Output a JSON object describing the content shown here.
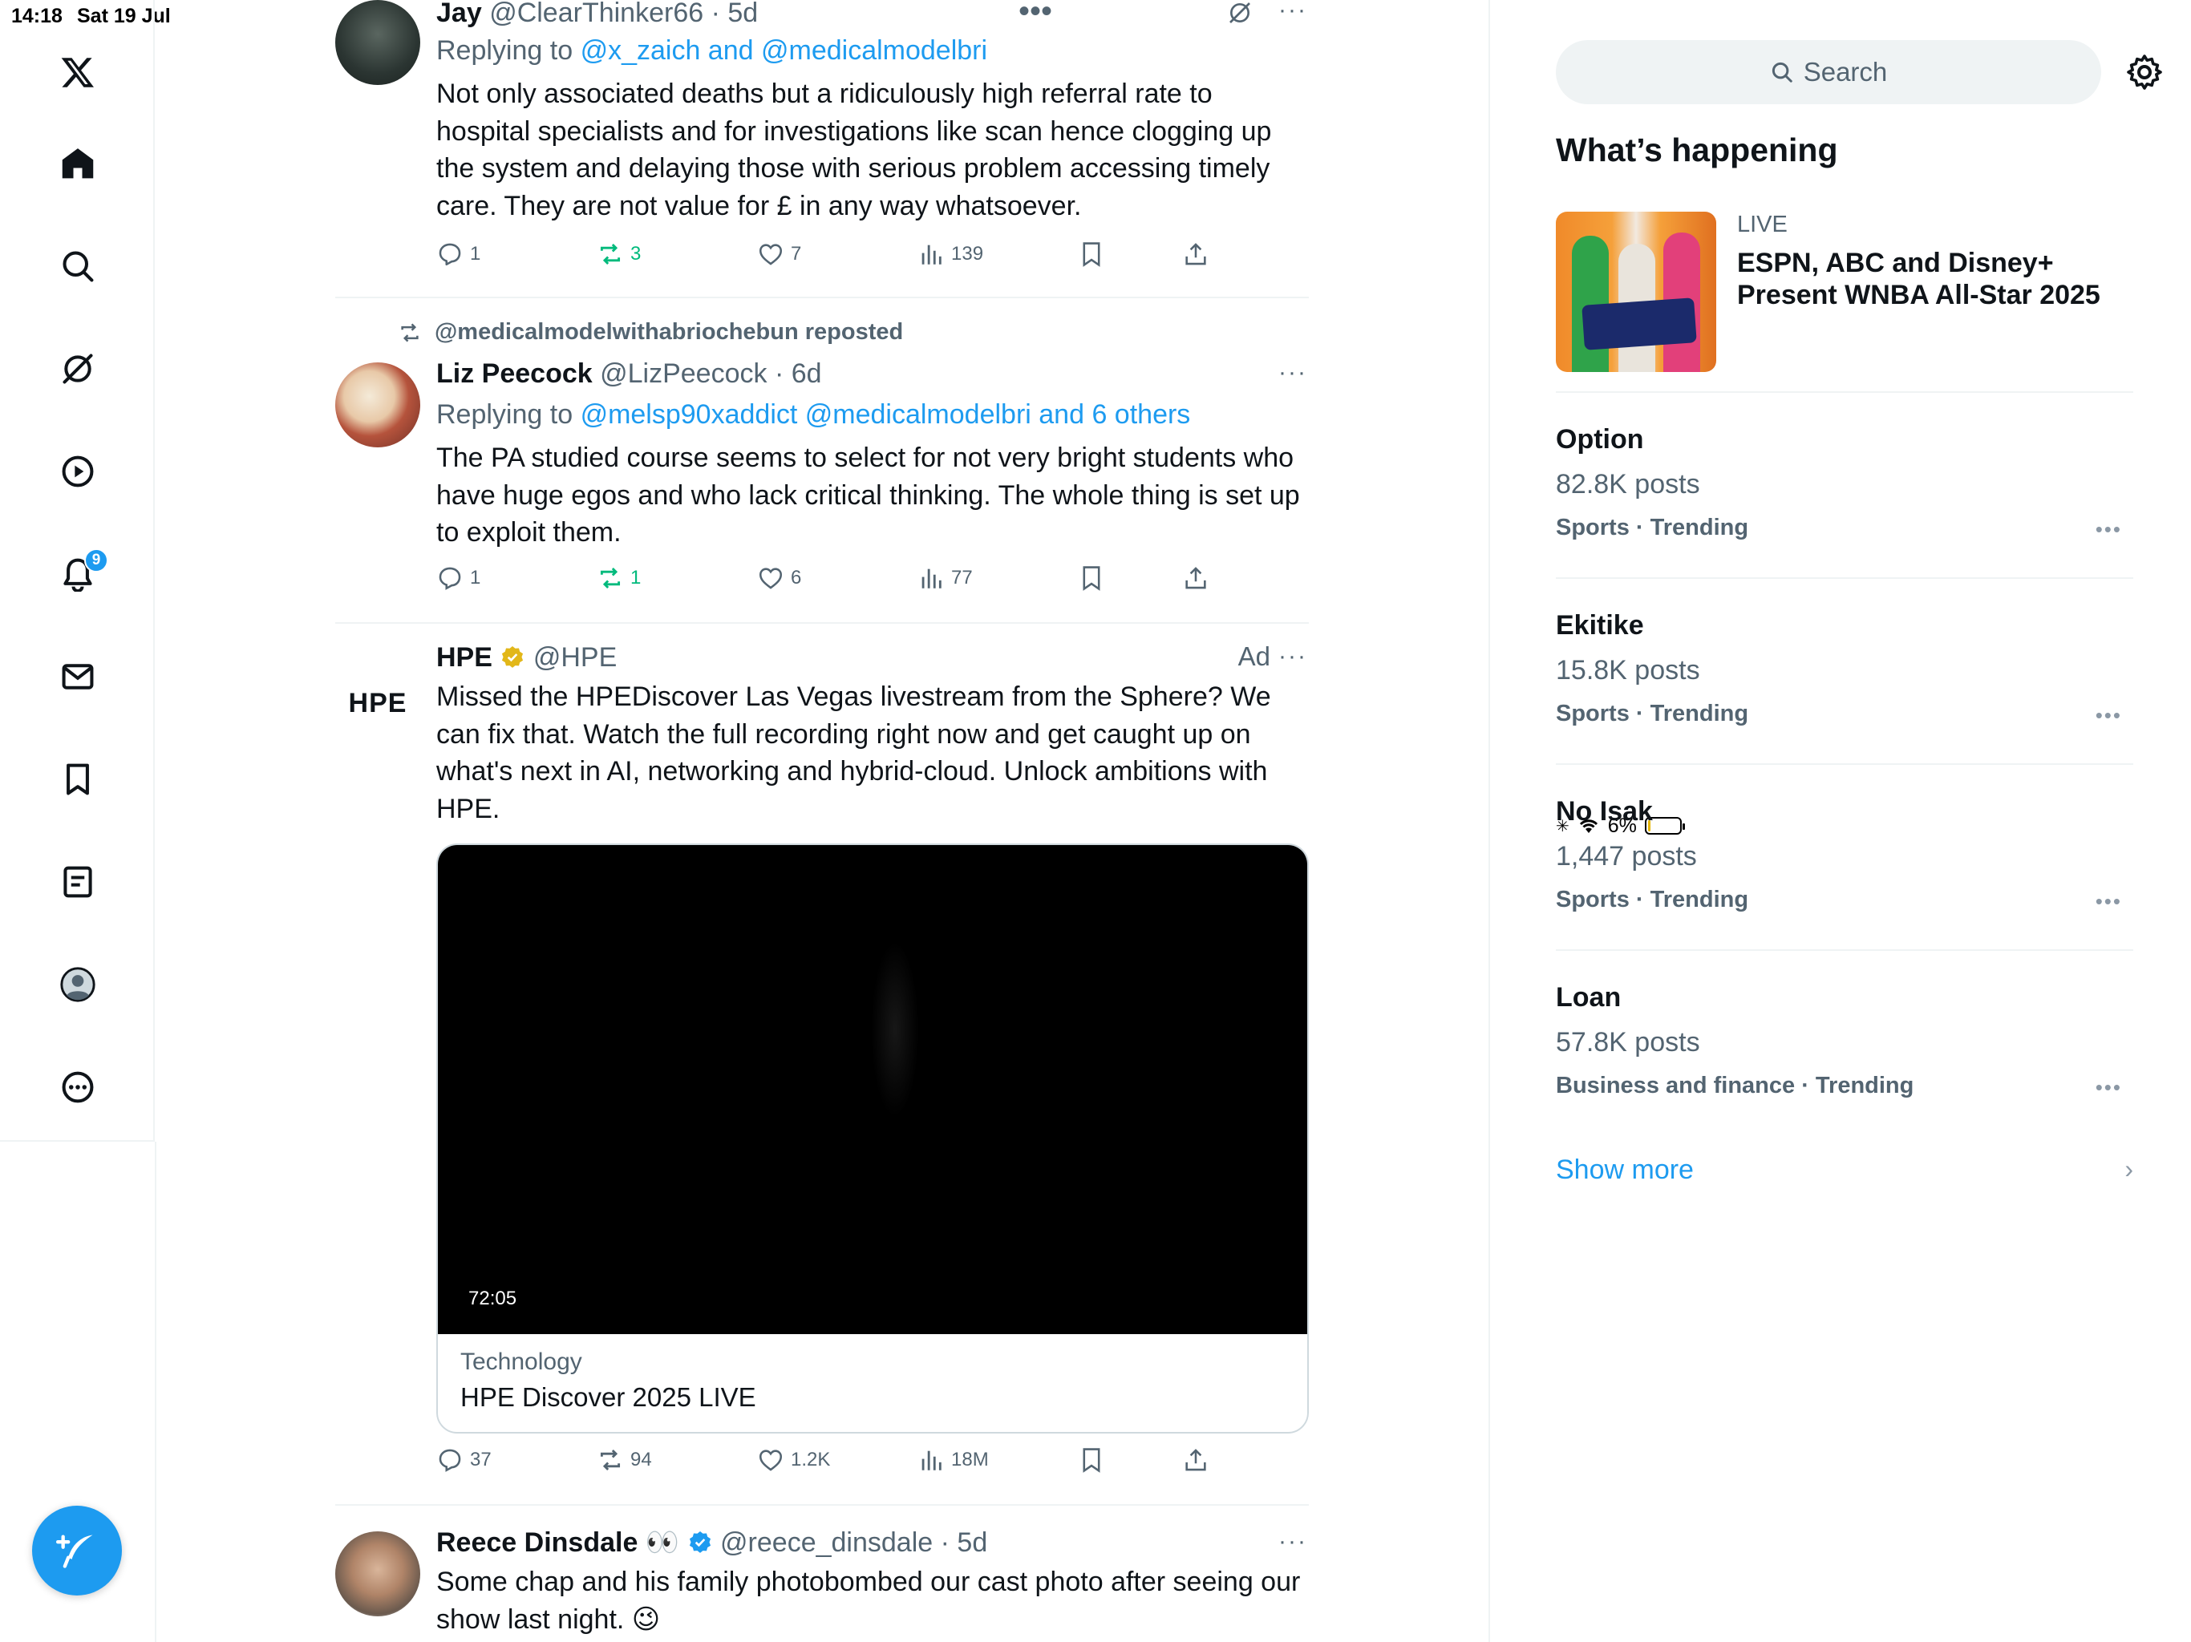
{
  "status": {
    "time": "14:18",
    "date": "Sat 19 Jul",
    "battery": "6%",
    "battery_level": 0.06
  },
  "nav": {
    "notifications_badge": "9"
  },
  "tweets": [
    {
      "name": "Jay",
      "handle": "@ClearThinker66",
      "age": "· 5d",
      "replying_prefix": "Replying to",
      "replying_to": "@x_zaich and @medicalmodelbri",
      "text": "Not only associated deaths but a ridiculously high referral rate to hospital specialists and for investigations like scan hence clogging up the system and delaying those with serious problem accessing timely care. They are not value for £ in any way whatsoever.",
      "replies": "1",
      "reposts": "3",
      "likes": "7",
      "views": "139"
    },
    {
      "repost_label": "@medicalmodelwithabriochebun reposted",
      "name": "Liz Peecock",
      "handle": "@LizPeecock",
      "age": "· 6d",
      "replying_prefix": "Replying to",
      "replying_to": "@melsp90xaddict @medicalmodelbri and 6 others",
      "text": "The PA studied course seems to select for not very bright students who have huge egos and who lack critical thinking.  The whole thing is set up to exploit them.",
      "replies": "1",
      "reposts": "1",
      "likes": "6",
      "views": "77"
    },
    {
      "name": "HPE",
      "handle": "@HPE",
      "ad_label": "Ad",
      "logo_text": "HPE",
      "text": "Missed the HPEDiscover Las Vegas livestream from the Sphere? We can fix that. Watch the full recording right now and get caught up on what's next in AI, networking and hybrid-cloud. Unlock ambitions with HPE.",
      "video_duration": "72:05",
      "card_category": "Technology",
      "card_title": "HPE Discover 2025 LIVE",
      "replies": "37",
      "reposts": "94",
      "likes": "1.2K",
      "views": "18M"
    },
    {
      "name": "Reece Dinsdale 👀",
      "handle": "@reece_dinsdale",
      "age": "· 5d",
      "text": "Some chap and his family photobombed our cast photo after seeing our show last night. 😉"
    }
  ],
  "sidebar": {
    "search_placeholder": "Search",
    "heading": "What’s happening",
    "live_label": "LIVE",
    "live_title": "ESPN, ABC and Disney+ Present WNBA All-Star 2025",
    "trends": [
      {
        "name": "Option",
        "posts": "82.8K posts",
        "category": "Sports · Trending"
      },
      {
        "name": "Ekitike",
        "posts": "15.8K posts",
        "category": "Sports · Trending"
      },
      {
        "name": "No Isak",
        "posts": "1,447 posts",
        "category": "Sports · Trending"
      },
      {
        "name": "Loan",
        "posts": "57.8K posts",
        "category": "Business and finance · Trending"
      }
    ],
    "show_more": "Show more"
  },
  "colors": {
    "accent": "#1d9bf0",
    "repost_green": "#00ba7c",
    "secondary_text": "#536471"
  }
}
